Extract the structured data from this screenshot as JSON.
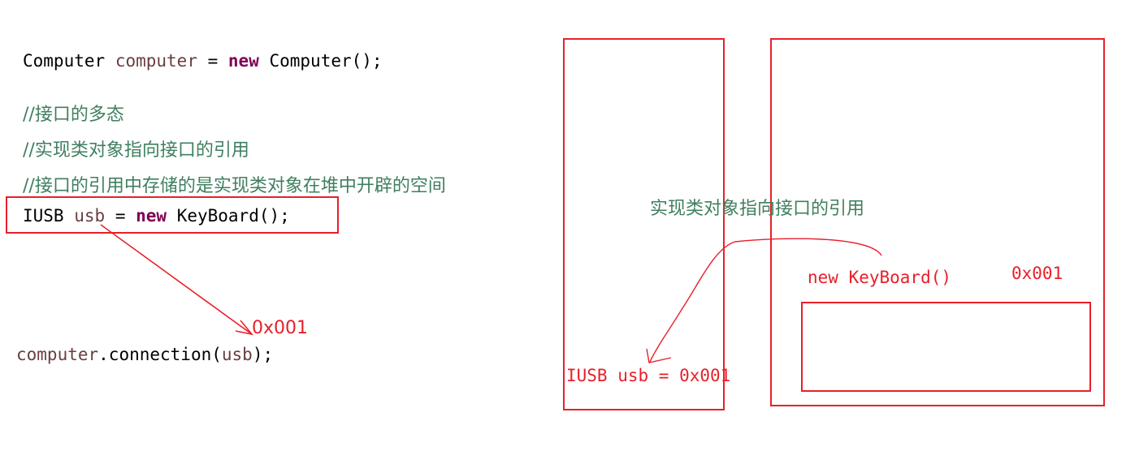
{
  "code": {
    "line1": {
      "type": "Computer",
      "var": "computer",
      "op": " = ",
      "kw": "new",
      "rest": " Computer();"
    },
    "comment1": "//接口的多态",
    "comment2": "//实现类对象指向接口的引用",
    "comment3": "//接口的引用中存储的是实现类对象在堆中开辟的空间",
    "line2": {
      "type": "IUSB",
      "var": "usb",
      "op": " = ",
      "kw": "new",
      "rest": " KeyBoard();"
    },
    "line3": {
      "obj": "computer",
      "rest1": ".connection(",
      "arg": "usb",
      "rest2": ");"
    }
  },
  "annotations": {
    "left_address": "0x001",
    "memory_label": "实现类对象指向接口的引用",
    "heap_object": "new KeyBoard()",
    "heap_address": "0x001",
    "stack_var": "IUSB usb = 0x001"
  },
  "colors": {
    "red": "#e8202a",
    "comment": "#3f7f5f",
    "keyword": "#7f0055",
    "variable": "#6a3e3e"
  }
}
